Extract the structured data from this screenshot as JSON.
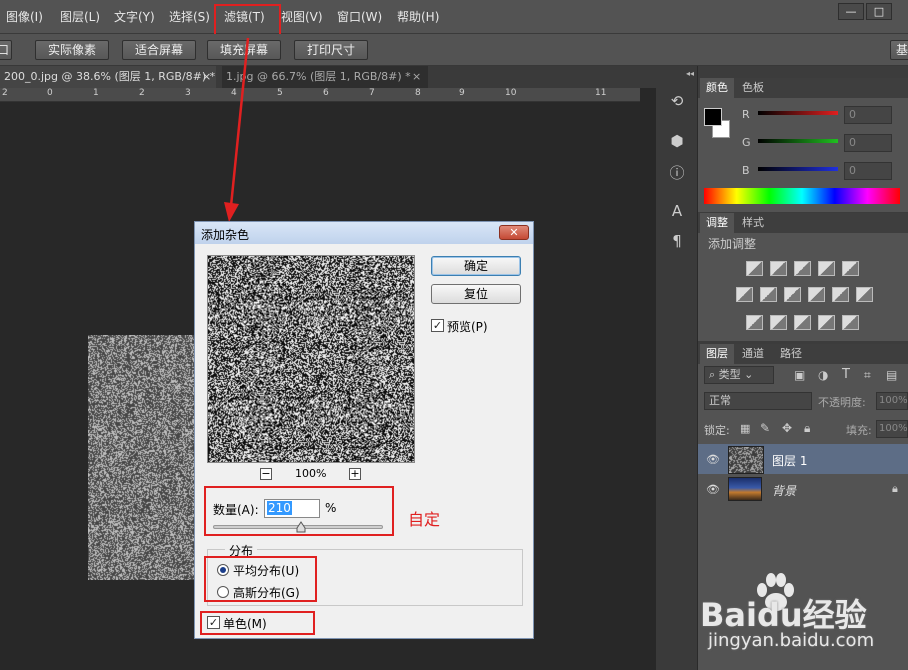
{
  "menubar": {
    "items": [
      "图像(I)",
      "图层(L)",
      "文字(Y)",
      "选择(S)",
      "滤镜(T)",
      "视图(V)",
      "窗口(W)",
      "帮助(H)"
    ],
    "window_controls": {
      "minimize": "—",
      "restore": "□"
    }
  },
  "optionsbar": {
    "left_stub": "口",
    "buttons": [
      "实际像素",
      "适合屏幕",
      "填充屏幕",
      "打印尺寸"
    ],
    "right_stub": "基"
  },
  "tabs": [
    {
      "label": "200_0.jpg @ 38.6% (图层 1, RGB/8#) *",
      "close": "×"
    },
    {
      "label": "1.jpg @ 66.7% (图层 1, RGB/8#) *",
      "close": "×"
    }
  ],
  "ruler": {
    "ticks": [
      "2",
      "0",
      "1",
      "2",
      "3",
      "4",
      "5",
      "6",
      "7",
      "8",
      "9",
      "10",
      "11"
    ]
  },
  "dialog": {
    "title": "添加杂色",
    "close": "✕",
    "ok": "确定",
    "reset": "复位",
    "preview_label": "预览(P)",
    "preview_checked": true,
    "zoom_out": "−",
    "zoom": "100%",
    "zoom_in": "+",
    "amount_label": "数量(A):",
    "amount_value": "210",
    "amount_unit": "%",
    "amount_slider_level": 0.52,
    "distribution_group": "分布",
    "uniform_label": "平均分布(U)",
    "gaussian_label": "高斯分布(G)",
    "selected_distribution": "uniform",
    "mono_label": "单色(M)",
    "mono_checked": true
  },
  "annotation": {
    "label": "自定"
  },
  "color_panel": {
    "tabs": [
      "颜色",
      "色板"
    ],
    "channels": [
      {
        "name": "R",
        "value": "0",
        "color": "#e02020"
      },
      {
        "name": "G",
        "value": "0",
        "color": "#20c020"
      },
      {
        "name": "B",
        "value": "0",
        "color": "#2030e0"
      }
    ]
  },
  "adjust_panel": {
    "tabs": [
      "调整",
      "样式"
    ],
    "title": "添加调整"
  },
  "layers_panel": {
    "tabs": [
      "图层",
      "通道",
      "路径"
    ],
    "filter_label": "类型",
    "blend_mode": "正常",
    "opacity_label": "不透明度:",
    "opacity_value": "100%",
    "lock_label": "锁定:",
    "fill_label": "填充:",
    "fill_value": "100%",
    "layers": [
      {
        "name": "图层 1",
        "selected": true
      },
      {
        "name": "背景",
        "selected": false,
        "locked": true
      }
    ]
  },
  "watermark": {
    "brand": "Baidu经验",
    "url": "jingyan.baidu.com"
  }
}
